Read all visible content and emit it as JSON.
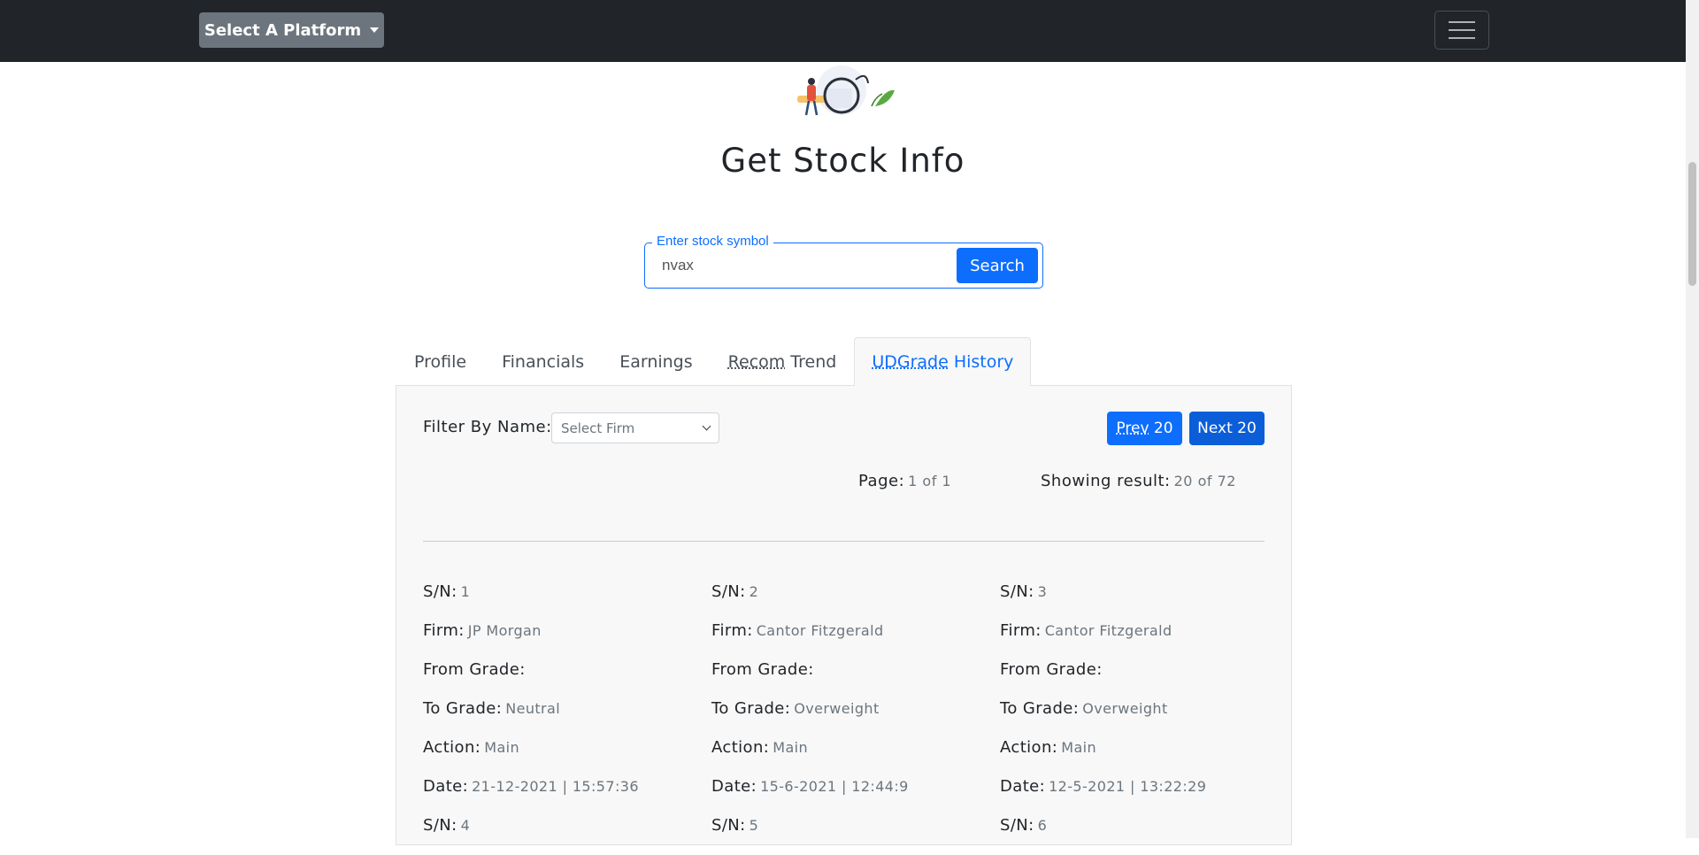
{
  "navbar": {
    "platform_label": "Select A Platform"
  },
  "title": "Get Stock Info",
  "search": {
    "legend": "Enter stock symbol",
    "value": "nvax",
    "button_label": "Search"
  },
  "tabs": [
    {
      "label": "Profile"
    },
    {
      "label": "Financials"
    },
    {
      "label": "Earnings"
    },
    {
      "label": "Recom",
      "label_rest": " Trend"
    },
    {
      "label": "UDGrade",
      "label_rest": " History",
      "active": true
    }
  ],
  "filter": {
    "label": "Filter By Name:",
    "select_value": "Select Firm"
  },
  "pagination": {
    "prev_label": "Prev",
    "prev_rest": " 20",
    "next_label": "Next 20",
    "page_label": "Page:",
    "page_value": "1 of 1",
    "showing_label": "Showing result:",
    "showing_value": "20 of 72"
  },
  "field_labels": {
    "sn": "S/N:",
    "firm": "Firm:",
    "from": "From Grade:",
    "to": "To Grade:",
    "action": "Action:",
    "date": "Date:"
  },
  "records": [
    {
      "sn": "1",
      "firm": "JP Morgan",
      "from": "",
      "to": "Neutral",
      "action": "Main",
      "date": "21-12-2021 | 15:57:36"
    },
    {
      "sn": "2",
      "firm": "Cantor Fitzgerald",
      "from": "",
      "to": "Overweight",
      "action": "Main",
      "date": "15-6-2021 | 12:44:9"
    },
    {
      "sn": "3",
      "firm": "Cantor Fitzgerald",
      "from": "",
      "to": "Overweight",
      "action": "Main",
      "date": "12-5-2021 | 13:22:29"
    },
    {
      "sn": "4"
    },
    {
      "sn": "5"
    },
    {
      "sn": "6"
    }
  ],
  "colors": {
    "navbar": "#212529",
    "primary": "#0d6efd",
    "secondary": "#6c757d"
  }
}
